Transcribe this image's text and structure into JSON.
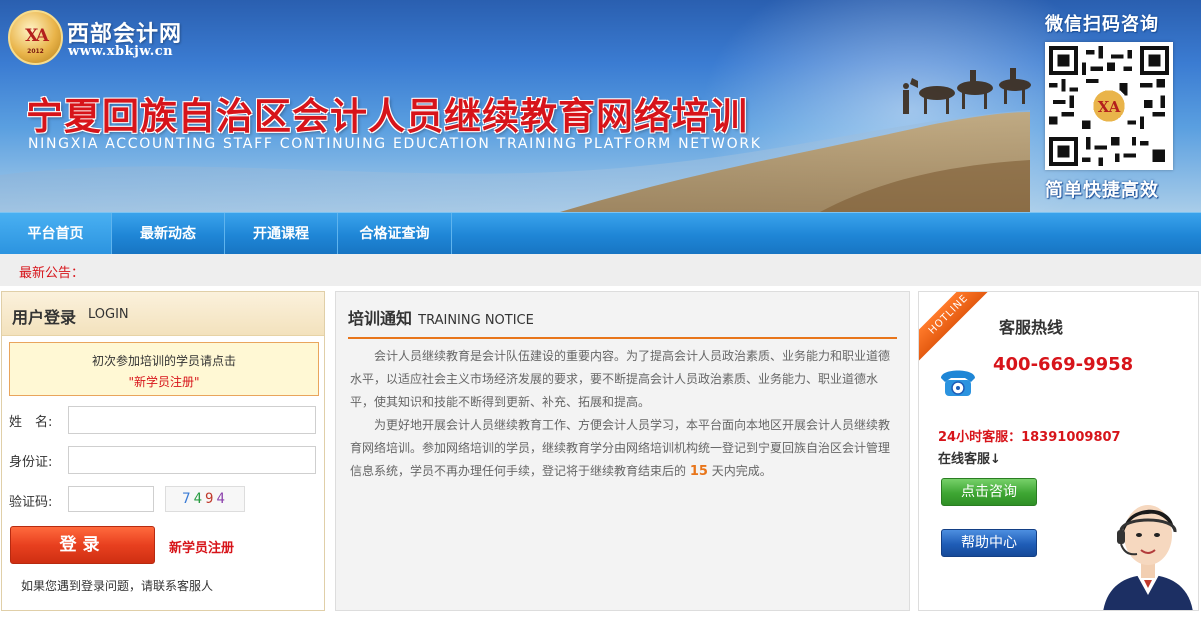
{
  "brand": {
    "logo_mark": "XA",
    "logo_year": "2012",
    "name": "西部会计网",
    "url": "www.xbkjw.cn"
  },
  "banner": {
    "title": "宁夏回族自治区会计人员继续教育网络培训",
    "subtitle": "NINGXIA ACCOUNTING STAFF CONTINUING EDUCATION TRAINING PLATFORM NETWORK",
    "qr_caption_top": "微信扫码咨询",
    "qr_caption_bottom": "简单快捷高效"
  },
  "nav": {
    "items": [
      {
        "label": "平台首页",
        "active": true
      },
      {
        "label": "最新动态",
        "active": false
      },
      {
        "label": "开通课程",
        "active": false
      },
      {
        "label": "合格证查询",
        "active": false
      }
    ]
  },
  "announcement": {
    "label": "最新公告："
  },
  "login": {
    "title_zh": "用户登录",
    "title_en": "LOGIN",
    "first_time_line1": "初次参加培训的学员请点击",
    "first_time_line2": "\"新学员注册\"",
    "name_label": "姓　名:",
    "id_label": "身份证:",
    "captcha_label": "验证码:",
    "name_value": "",
    "id_value": "",
    "captcha_value": "",
    "captcha_digits": [
      "7",
      "4",
      "9",
      "4"
    ],
    "captcha_colors": [
      "#3a7bd5",
      "#2a9d43",
      "#c0392b",
      "#8e44ad"
    ],
    "submit_label": "登录",
    "register_label": "新学员注册",
    "help_text": "如果您遇到登录问题，请联系客服人"
  },
  "training_notice": {
    "title_zh": "培训通知",
    "title_en": "TRAINING NOTICE",
    "paragraph1": "会计人员继续教育是会计队伍建设的重要内容。为了提高会计人员政治素质、业务能力和职业道德水平，以适应社会主义市场经济发展的要求，要不断提高会计人员政治素质、业务能力、职业道德水平，使其知识和技能不断得到更新、补充、拓展和提高。",
    "paragraph2_before": "为更好地开展会计人员继续教育工作、方便会计人员学习，本平台面向本地区开展会计人员继续教育网络培训。参加网络培训的学员，继续教育学分由网络培训机构统一登记到宁夏回族自治区会计管理信息系统，学员不再办理任何手续，登记将于继续教育结束后的",
    "paragraph2_days": "15",
    "paragraph2_after": "天内完成。"
  },
  "service": {
    "ribbon": "HOTLINE",
    "title": "客服热线",
    "phone": "400-669-9958",
    "hotline_24": "24小时客服：18391009807",
    "online_label": "在线客服↓",
    "consult_label": "点击咨询",
    "help_label": "帮助中心"
  },
  "colors": {
    "accent_red": "#d7141a",
    "nav_blue": "#1f86d6",
    "notice_orange": "#e8751a",
    "consult_green": "#3ea633",
    "help_blue": "#1f5db7"
  }
}
